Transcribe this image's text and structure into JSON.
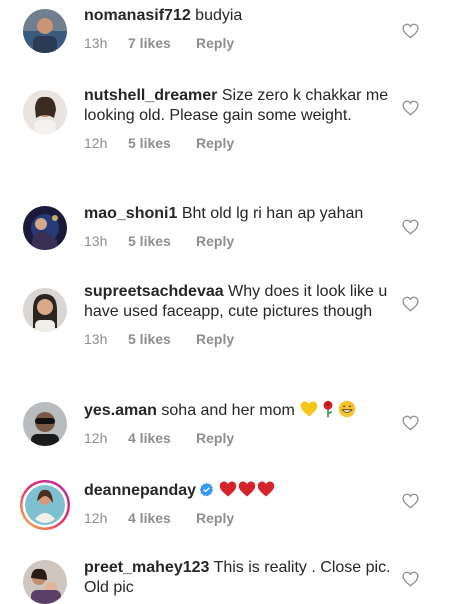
{
  "comments": [
    {
      "username": "nomanasif712",
      "text": "budyia",
      "time": "13h",
      "likes": "7 likes",
      "reply": "Reply",
      "avatar_icon": "profile-photo-man"
    },
    {
      "username": "nutshell_dreamer",
      "text": "Size zero k chakkar me looking old. Please gain some weight.",
      "time": "12h",
      "likes": "5 likes",
      "reply": "Reply",
      "avatar_icon": "profile-photo-woman"
    },
    {
      "username": "mao_shoni1",
      "text": "Bht old lg ri han ap yahan",
      "time": "13h",
      "likes": "5 likes",
      "reply": "Reply",
      "avatar_icon": "profile-photo-concert"
    },
    {
      "username": "supreetsachdevaa",
      "text": "Why does it look like u have used faceapp, cute pictures though",
      "time": "13h",
      "likes": "5 likes",
      "reply": "Reply",
      "avatar_icon": "profile-photo-woman"
    },
    {
      "username": "yes.aman",
      "text": "soha and her mom",
      "time": "12h",
      "likes": "4 likes",
      "reply": "Reply",
      "avatar_icon": "profile-photo-sunglasses",
      "emojis": [
        "yellow-heart-emoji",
        "rose-emoji",
        "grinning-face-emoji"
      ]
    },
    {
      "username": "deannepanday",
      "text": "",
      "time": "12h",
      "likes": "4 likes",
      "reply": "Reply",
      "avatar_icon": "profile-photo-story-ring",
      "verified": true,
      "emojis": [
        "red-heart-emoji",
        "red-heart-emoji",
        "red-heart-emoji"
      ]
    },
    {
      "username": "preet_mahey123",
      "text": "This is reality . Close pic. Old pic",
      "time": "",
      "likes": "",
      "reply": "",
      "avatar_icon": "profile-photo-family"
    }
  ],
  "colors": {
    "text": "#262626",
    "meta": "#8e8e8e",
    "verified": "#3897f0",
    "heart_outline": "#8e8e8e"
  }
}
